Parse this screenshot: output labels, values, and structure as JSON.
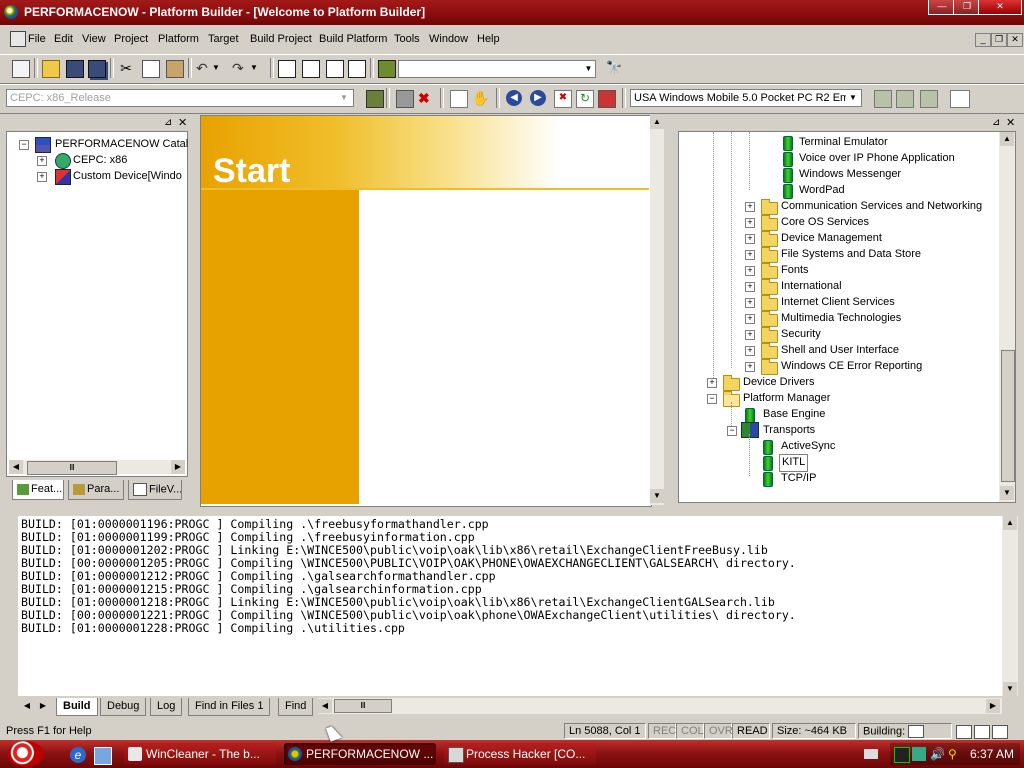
{
  "window": {
    "title": "PERFORMACENOW - Platform Builder - [Welcome to Platform Builder]"
  },
  "menu": [
    "File",
    "Edit",
    "View",
    "Project",
    "Platform",
    "Target",
    "Build Project",
    "Build Platform",
    "Tools",
    "Window",
    "Help"
  ],
  "toolbar": {
    "find_combo_value": "",
    "config_combo_value": "CEPC: x86_Release",
    "device_combo_value": "USA Windows Mobile 5.0 Pocket PC R2 Em"
  },
  "workspace": {
    "tree": {
      "root": "PERFORMACENOW Catal",
      "children": [
        "CEPC: x86",
        "Custom Device[Windo"
      ]
    },
    "tabs": [
      "Feat...",
      "Para...",
      "FileV..."
    ]
  },
  "start_page": {
    "heading": "Start"
  },
  "catalog": {
    "items_leaf_top": [
      "Terminal Emulator",
      "Voice over IP Phone Application",
      "Windows Messenger",
      "WordPad"
    ],
    "folders": [
      "Communication Services and Networking",
      "Core OS Services",
      "Device Management",
      "File Systems and Data Store",
      "Fonts",
      "International",
      "Internet Client Services",
      "Multimedia Technologies",
      "Security",
      "Shell and User Interface",
      "Windows CE Error Reporting"
    ],
    "device_drivers": "Device Drivers",
    "platform_manager": "Platform Manager",
    "base_engine": "Base Engine",
    "transports": "Transports",
    "transport_items": [
      "ActiveSync",
      "KITL",
      "TCP/IP"
    ]
  },
  "output": {
    "lines": [
      "BUILD: [01:0000001196:PROGC ] Compiling .\\freebusyformathandler.cpp",
      "BUILD: [01:0000001199:PROGC ] Compiling .\\freebusyinformation.cpp",
      "BUILD: [01:0000001202:PROGC ] Linking E:\\WINCE500\\public\\voip\\oak\\lib\\x86\\retail\\ExchangeClientFreeBusy.lib",
      "BUILD: [00:0000001205:PROGC ] Compiling \\WINCE500\\PUBLIC\\VOIP\\OAK\\PHONE\\OWAEXCHANGECLIENT\\GALSEARCH\\ directory.",
      "BUILD: [01:0000001212:PROGC ] Compiling .\\galsearchformathandler.cpp",
      "BUILD: [01:0000001215:PROGC ] Compiling .\\galsearchinformation.cpp",
      "BUILD: [01:0000001218:PROGC ] Linking E:\\WINCE500\\public\\voip\\oak\\lib\\x86\\retail\\ExchangeClientGALSearch.lib",
      "BUILD: [00:0000001221:PROGC ] Compiling \\WINCE500\\public\\voip\\oak\\phone\\OWAExchangeClient\\utilities\\ directory.",
      "BUILD: [01:0000001228:PROGC ] Compiling .\\utilities.cpp"
    ],
    "tabs": [
      "Build",
      "Debug",
      "Log",
      "Find in Files 1",
      "Find"
    ]
  },
  "status": {
    "help": "Press F1 for Help",
    "position": "Ln 5088, Col 1",
    "rec": "REC",
    "col": "COL",
    "ovr": "OVR",
    "read": "READ",
    "size": "Size: ~464 KB",
    "building": "Building:"
  },
  "taskbar": {
    "tasks": [
      "WinCleaner - The b...",
      "PERFORMACENOW ...",
      "Process Hacker [CO..."
    ],
    "clock": "6:37 AM"
  }
}
